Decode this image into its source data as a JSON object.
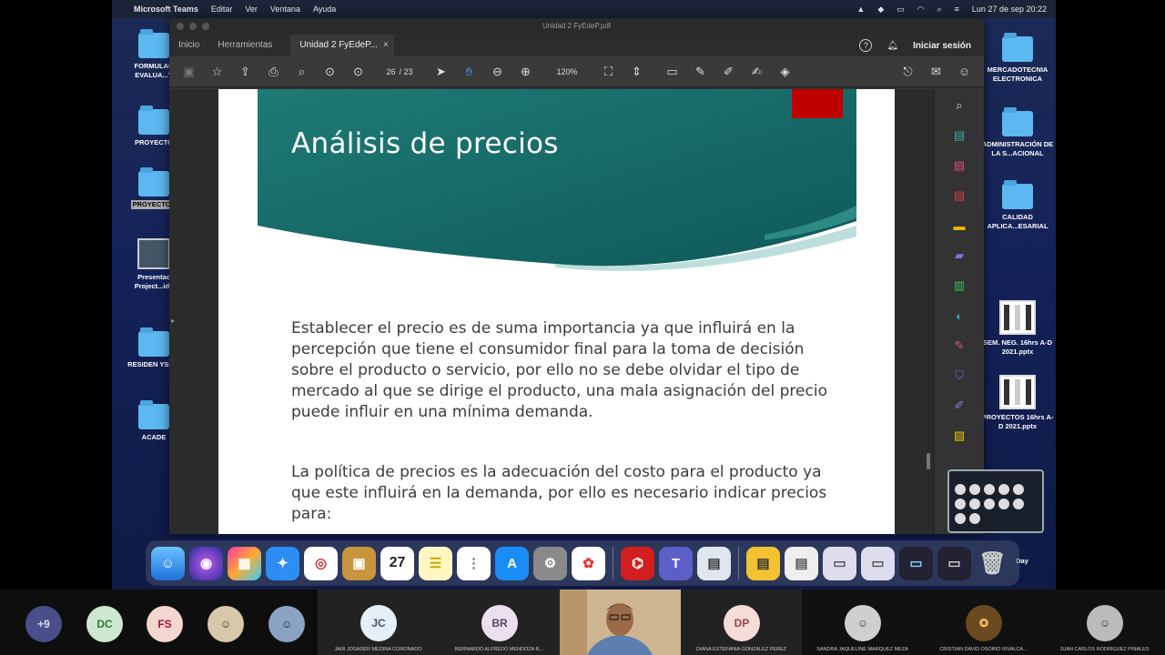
{
  "menubar": {
    "app": "Microsoft Teams",
    "items": [
      "Editar",
      "Ver",
      "Ventana",
      "Ayuda"
    ],
    "datetime": "Lun 27 de sep  20:22"
  },
  "desktop": {
    "left_icons": [
      {
        "label": "FORMULAC EVALUA...Y"
      },
      {
        "label": "PROYECTO"
      },
      {
        "label": "PROYECTOS"
      },
      {
        "label": "Presentac Project...idx"
      },
      {
        "label": "RESIDEN YSIDE"
      },
      {
        "label": "ACADE"
      }
    ],
    "right_icons": [
      {
        "label": "MERCADOTECNIA ELECTRONICA"
      },
      {
        "label": "ADMINISTRACIÓN DE LA S...ACIONAL"
      },
      {
        "label": "CALIDAD APLICA...ESARIAL"
      },
      {
        "label": "SEM. NEG. 16hrs A-D 2021.pptx"
      },
      {
        "label": "PROYECTOS 16hrs A-D 2021.pptx"
      },
      {
        "label": "Day"
      }
    ]
  },
  "acrobat": {
    "window_title": "Unidad 2 FyEdeP.pdf",
    "tabs": {
      "inicio": "Inicio",
      "herramientas": "Herramientas",
      "doc": "Unidad 2 FyEdeP..."
    },
    "signin": "Iniciar sesión",
    "page_current": "26",
    "page_total": "/ 23",
    "zoom": "120%"
  },
  "slide": {
    "title": "Análisis de precios",
    "paragraph1": "Establecer el precio es de suma importancia ya que influirá en la percepción que tiene el consumidor final para la toma de decisión sobre el producto o servicio, por ello no se debe olvidar el tipo de mercado al que se dirige el producto, una mala asignación del precio puede influir en una mínima demanda.",
    "paragraph2": "La política de precios es la adecuación del costo para el producto ya que este influirá en la demanda, por ello es necesario indicar precios para:",
    "colors": {
      "header": "#176d6a",
      "accent": "#c00000"
    }
  },
  "participants": {
    "more": "+9",
    "initials_small": [
      "DC",
      "FS"
    ],
    "tiles": [
      {
        "initials": "JC",
        "name": "JAIR JOSADER MEDINA CORONADO"
      },
      {
        "initials": "BR",
        "name": "BERNARDO ALFREDO MENDOZA R..."
      },
      {
        "initials": "",
        "name": ""
      },
      {
        "initials": "DP",
        "name": "DIANA ESTEFANÍA GONZÁLEZ PÉREZ"
      },
      {
        "initials": "",
        "name": "SANDRA JAQUELINE MÁRQUEZ MEZA"
      },
      {
        "initials": "",
        "name": "CRISTIAN DAVID OSORIO RIVALCA..."
      },
      {
        "initials": "",
        "name": "JUAN CARLOS RODRÍGUEZ PINALES"
      }
    ]
  }
}
